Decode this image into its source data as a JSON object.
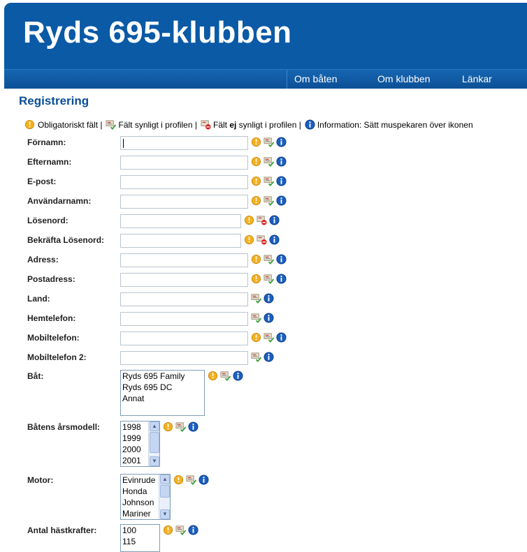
{
  "site": {
    "title": "Ryds 695-klubben"
  },
  "nav": {
    "items": [
      {
        "label": "Om båten"
      },
      {
        "label": "Om klubben"
      },
      {
        "label": "Länkar"
      }
    ]
  },
  "page": {
    "heading": "Registrering"
  },
  "legend": {
    "required": "Obligatoriskt fält |",
    "visible": "Fält synligt i profilen |",
    "hidden_prefix": "Fält ",
    "hidden_emph": "ej",
    "hidden_suffix": " synligt i profilen |",
    "info": "Information: Sätt muspekaren över ikonen"
  },
  "form": {
    "fields": [
      {
        "label": "Förnamn:",
        "value": "",
        "required": true,
        "visible": true
      },
      {
        "label": "Efternamn:",
        "value": "",
        "required": true,
        "visible": true
      },
      {
        "label": "E-post:",
        "value": "",
        "required": true,
        "visible": true
      },
      {
        "label": "Användarnamn:",
        "value": "",
        "required": true,
        "visible": true
      },
      {
        "label": "Lösenord:",
        "value": "",
        "required": true,
        "visible": false
      },
      {
        "label": "Bekräfta Lösenord:",
        "value": "",
        "required": true,
        "visible": false
      },
      {
        "label": "Adress:",
        "value": "",
        "required": true,
        "visible": true
      },
      {
        "label": "Postadress:",
        "value": "",
        "required": true,
        "visible": true
      },
      {
        "label": "Land:",
        "value": "",
        "required": false,
        "visible": true
      },
      {
        "label": "Hemtelefon:",
        "value": "",
        "required": false,
        "visible": true
      },
      {
        "label": "Mobiltelefon:",
        "value": "",
        "required": true,
        "visible": true
      },
      {
        "label": "Mobiltelefon 2:",
        "value": "",
        "required": false,
        "visible": true
      }
    ],
    "lists": [
      {
        "label": "Båt:",
        "options": [
          "Ryds 695 Family",
          "Ryds 695 DC",
          "Annat"
        ]
      },
      {
        "label": "Båtens årsmodell:",
        "options": [
          "1998",
          "1999",
          "2000",
          "2001"
        ]
      },
      {
        "label": "Motor:",
        "options": [
          "Evinrude",
          "Honda",
          "Johnson",
          "Mariner"
        ]
      },
      {
        "label": "Antal hästkrafter:",
        "options": [
          "100",
          "115"
        ]
      }
    ]
  },
  "colors": {
    "brand": "#0a5aa6",
    "heading": "#0a4f96"
  }
}
